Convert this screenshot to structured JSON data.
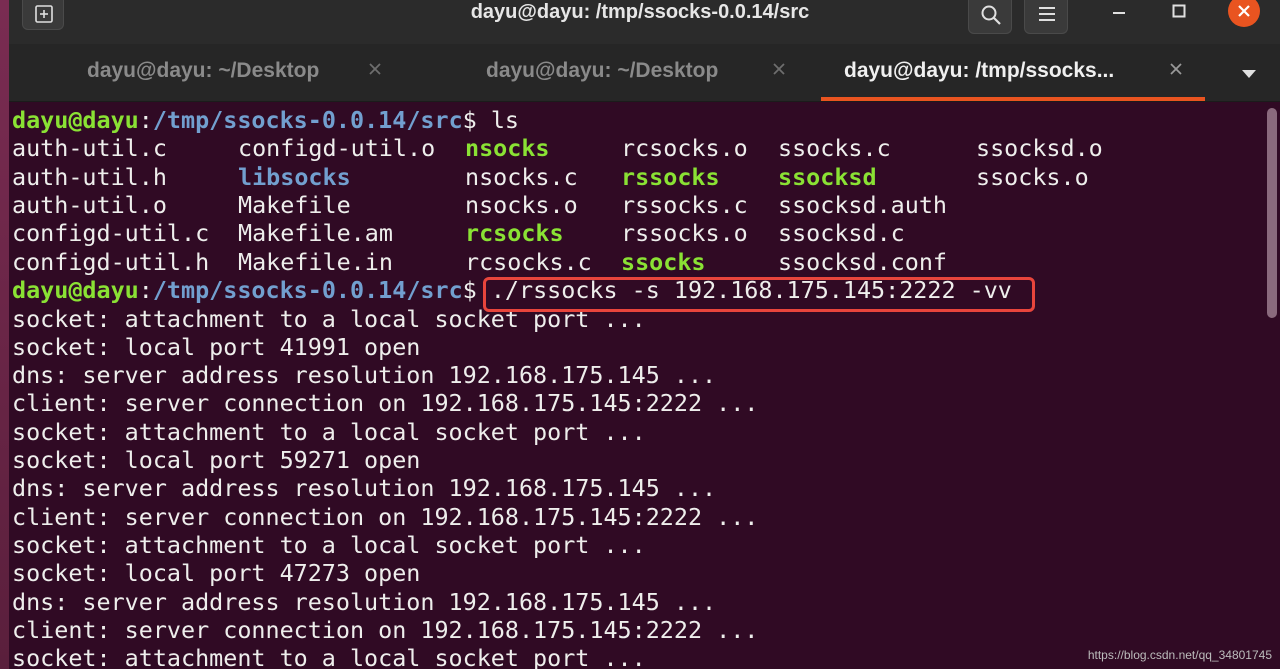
{
  "window": {
    "title": "dayu@dayu: /tmp/ssocks-0.0.14/src"
  },
  "tabs": [
    {
      "label": "dayu@dayu: ~/Desktop",
      "active": false
    },
    {
      "label": "dayu@dayu: ~/Desktop",
      "active": false
    },
    {
      "label": "dayu@dayu: /tmp/ssocks...",
      "active": true
    }
  ],
  "terminal": {
    "prompt": {
      "user": "dayu@dayu",
      "colon": ":",
      "path": "/tmp/ssocks-0.0.14/src",
      "dollar": "$ "
    },
    "cmd1": "ls",
    "ls_columns": [
      [
        {
          "name": "auth-util.c",
          "type": "file"
        },
        {
          "name": "auth-util.h",
          "type": "file"
        },
        {
          "name": "auth-util.o",
          "type": "file"
        },
        {
          "name": "configd-util.c",
          "type": "file"
        },
        {
          "name": "configd-util.h",
          "type": "file"
        }
      ],
      [
        {
          "name": "configd-util.o",
          "type": "file"
        },
        {
          "name": "libsocks",
          "type": "dir"
        },
        {
          "name": "Makefile",
          "type": "file"
        },
        {
          "name": "Makefile.am",
          "type": "file"
        },
        {
          "name": "Makefile.in",
          "type": "file"
        }
      ],
      [
        {
          "name": "nsocks",
          "type": "exe"
        },
        {
          "name": "nsocks.c",
          "type": "file"
        },
        {
          "name": "nsocks.o",
          "type": "file"
        },
        {
          "name": "rcsocks",
          "type": "exe"
        },
        {
          "name": "rcsocks.c",
          "type": "file"
        }
      ],
      [
        {
          "name": "rcsocks.o",
          "type": "file"
        },
        {
          "name": "rssocks",
          "type": "exe"
        },
        {
          "name": "rssocks.c",
          "type": "file"
        },
        {
          "name": "rssocks.o",
          "type": "file"
        },
        {
          "name": "ssocks",
          "type": "exe"
        }
      ],
      [
        {
          "name": "ssocks.c",
          "type": "file"
        },
        {
          "name": "ssocksd",
          "type": "exe"
        },
        {
          "name": "ssocksd.auth",
          "type": "file"
        },
        {
          "name": "ssocksd.c",
          "type": "file"
        },
        {
          "name": "ssocksd.conf",
          "type": "file"
        }
      ],
      [
        {
          "name": "ssocksd.o",
          "type": "file"
        },
        {
          "name": "ssocks.o",
          "type": "file"
        }
      ]
    ],
    "cmd2": "./rssocks -s 192.168.175.145:2222 -vv",
    "output": [
      "socket: attachment to a local socket port ...",
      "socket: local port 41991 open",
      "dns: server address resolution 192.168.175.145 ...",
      "client: server connection on 192.168.175.145:2222 ...",
      "socket: attachment to a local socket port ...",
      "socket: local port 59271 open",
      "dns: server address resolution 192.168.175.145 ...",
      "client: server connection on 192.168.175.145:2222 ...",
      "socket: attachment to a local socket port ...",
      "socket: local port 47273 open",
      "dns: server address resolution 192.168.175.145 ...",
      "client: server connection on 192.168.175.145:2222 ...",
      "socket: attachment to a local socket port ..."
    ]
  },
  "watermark": "https://blog.csdn.net/qq_34801745",
  "colors": {
    "background": "#300a24",
    "prompt_user": "#8ae234",
    "prompt_path": "#729fcf",
    "highlight": "#e8453c",
    "accent": "#e95420"
  },
  "icons": [
    "new-tab-icon",
    "search-icon",
    "hamburger-menu-icon",
    "minimize-icon",
    "maximize-icon",
    "close-icon",
    "tab-close-icon",
    "chevron-down-icon"
  ]
}
